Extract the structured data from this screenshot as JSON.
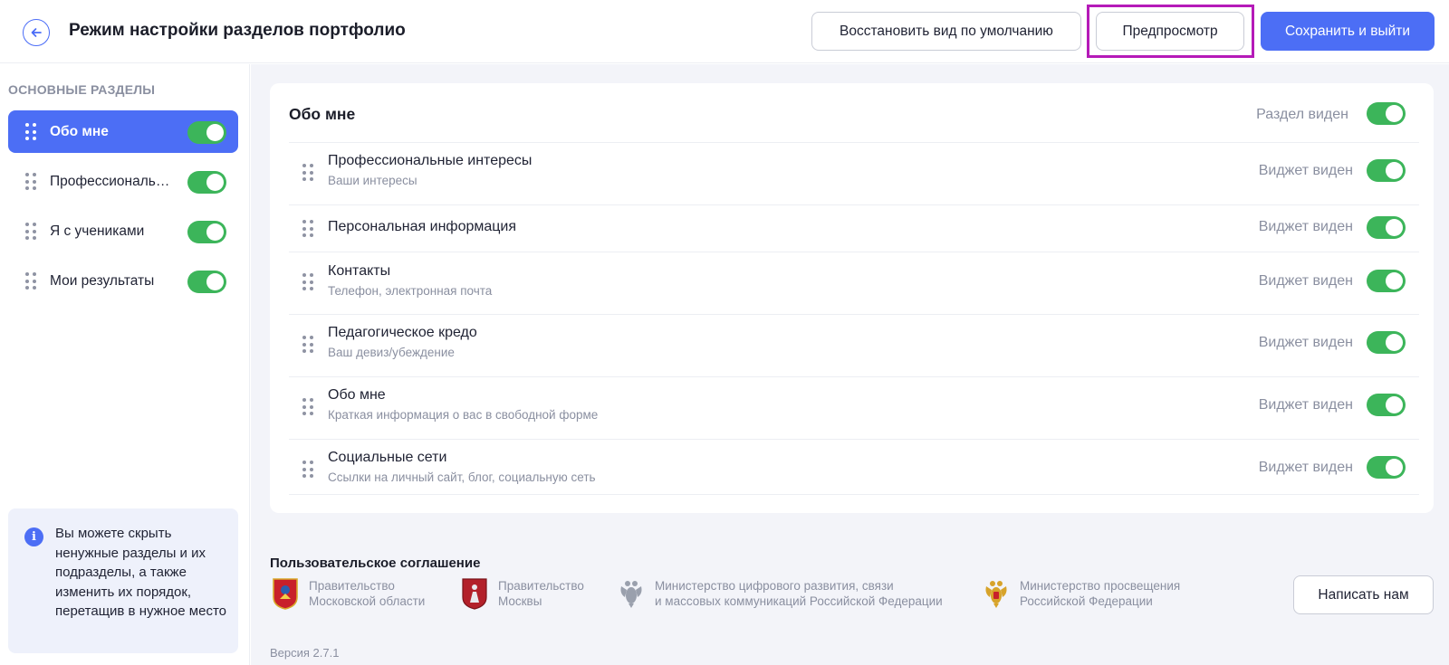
{
  "header": {
    "title": "Режим настройки разделов портфолио",
    "restore_label": "Восстановить вид по умолчанию",
    "preview_label": "Предпросмотр",
    "save_label": "Сохранить и выйти"
  },
  "sidebar": {
    "heading": "ОСНОВНЫЕ РАЗДЕЛЫ",
    "items": [
      {
        "label": "Обо мне",
        "active": true,
        "visible": true
      },
      {
        "label": "Профессиональные интересы",
        "active": false,
        "visible": true
      },
      {
        "label": "Я с учениками",
        "active": false,
        "visible": true
      },
      {
        "label": "Мои результаты",
        "active": false,
        "visible": true
      }
    ],
    "info_text": "Вы можете скрыть ненужные разделы и их подразделы, а также изменить их порядок, перетащив в нужное место"
  },
  "section": {
    "title": "Обо мне",
    "visibility_label": "Раздел виден",
    "visible": true,
    "widgets": [
      {
        "title": "Профессиональные интересы",
        "subtitle": "Ваши интересы",
        "visibility_label": "Виджет виден",
        "visible": true
      },
      {
        "title": "Персональная информация",
        "subtitle": "",
        "visibility_label": "Виджет виден",
        "visible": true
      },
      {
        "title": "Контакты",
        "subtitle": "Телефон, электронная почта",
        "visibility_label": "Виджет виден",
        "visible": true
      },
      {
        "title": "Педагогическое кредо",
        "subtitle": "Ваш девиз/убеждение",
        "visibility_label": "Виджет виден",
        "visible": true
      },
      {
        "title": "Обо мне",
        "subtitle": "Краткая информация о вас в свободной форме",
        "visibility_label": "Виджет виден",
        "visible": true
      },
      {
        "title": "Социальные сети",
        "subtitle": "Ссылки на личный сайт, блог, социальную сеть",
        "visibility_label": "Виджет виден",
        "visible": true
      }
    ]
  },
  "footer": {
    "agreement": "Пользовательское соглашение",
    "orgs": [
      {
        "line1": "Правительство",
        "line2": "Московской области",
        "icon": "moscow-oblast-emblem-icon"
      },
      {
        "line1": "Правительство",
        "line2": "Москвы",
        "icon": "moscow-emblem-icon"
      },
      {
        "line1": "Министерство цифрового развития, связи",
        "line2": "и массовых коммуникаций Российской Федерации",
        "icon": "russia-eagle-gray-icon"
      },
      {
        "line1": "Министерство просвещения",
        "line2": "Российской Федерации",
        "icon": "russia-eagle-color-icon"
      }
    ],
    "write_label": "Написать нам",
    "version": "Версия 2.7.1"
  },
  "colors": {
    "accent": "#4c6ef5",
    "toggle_on": "#3cb55a",
    "highlight": "#b51ab8",
    "muted_text": "#8a8fa0",
    "main_bg": "#f3f4f9"
  }
}
